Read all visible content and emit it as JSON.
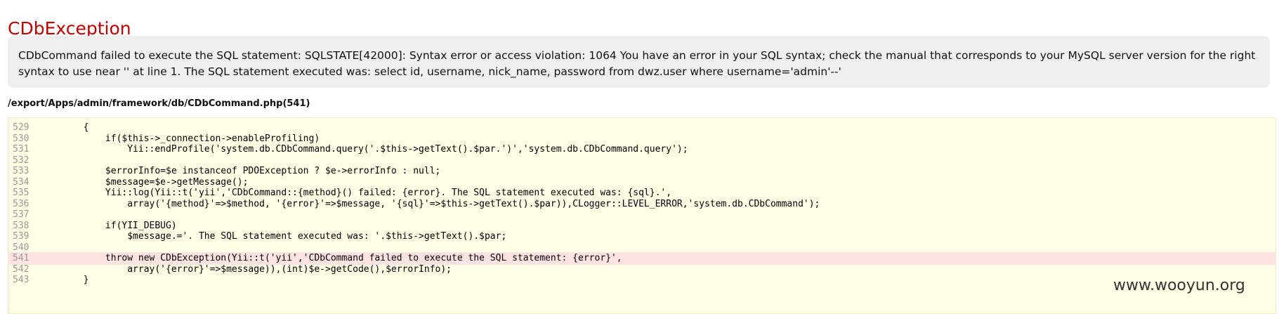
{
  "exception": {
    "title": "CDbException",
    "message": "CDbCommand failed to execute the SQL statement: SQLSTATE[42000]: Syntax error or access violation: 1064 You have an error in your SQL syntax; check the manual that corresponds to your MySQL server version for the right syntax to use near '' at line 1. The SQL statement executed was: select id, username, nick_name, password from dwz.user where username='admin'--'"
  },
  "source": {
    "file": "/export/Apps/admin/framework/db/CDbCommand.php(541)",
    "error_line": "541",
    "lines": [
      {
        "num": "529",
        "code": "        {"
      },
      {
        "num": "530",
        "code": "            if($this->_connection->enableProfiling)"
      },
      {
        "num": "531",
        "code": "                Yii::endProfile('system.db.CDbCommand.query('.$this->getText().$par.')','system.db.CDbCommand.query');"
      },
      {
        "num": "532",
        "code": ""
      },
      {
        "num": "533",
        "code": "            $errorInfo=$e instanceof PDOException ? $e->errorInfo : null;"
      },
      {
        "num": "534",
        "code": "            $message=$e->getMessage();"
      },
      {
        "num": "535",
        "code": "            Yii::log(Yii::t('yii','CDbCommand::{method}() failed: {error}. The SQL statement executed was: {sql}.',"
      },
      {
        "num": "536",
        "code": "                array('{method}'=>$method, '{error}'=>$message, '{sql}'=>$this->getText().$par)),CLogger::LEVEL_ERROR,'system.db.CDbCommand');"
      },
      {
        "num": "537",
        "code": ""
      },
      {
        "num": "538",
        "code": "            if(YII_DEBUG)"
      },
      {
        "num": "539",
        "code": "                $message.='. The SQL statement executed was: '.$this->getText().$par;"
      },
      {
        "num": "540",
        "code": ""
      },
      {
        "num": "541",
        "code": "            throw new CDbException(Yii::t('yii','CDbCommand failed to execute the SQL statement: {error}',"
      },
      {
        "num": "542",
        "code": "                array('{error}'=>$message)),(int)$e->getCode(),$errorInfo);"
      },
      {
        "num": "543",
        "code": "        }"
      }
    ]
  },
  "watermark": "www.wooyun.org"
}
